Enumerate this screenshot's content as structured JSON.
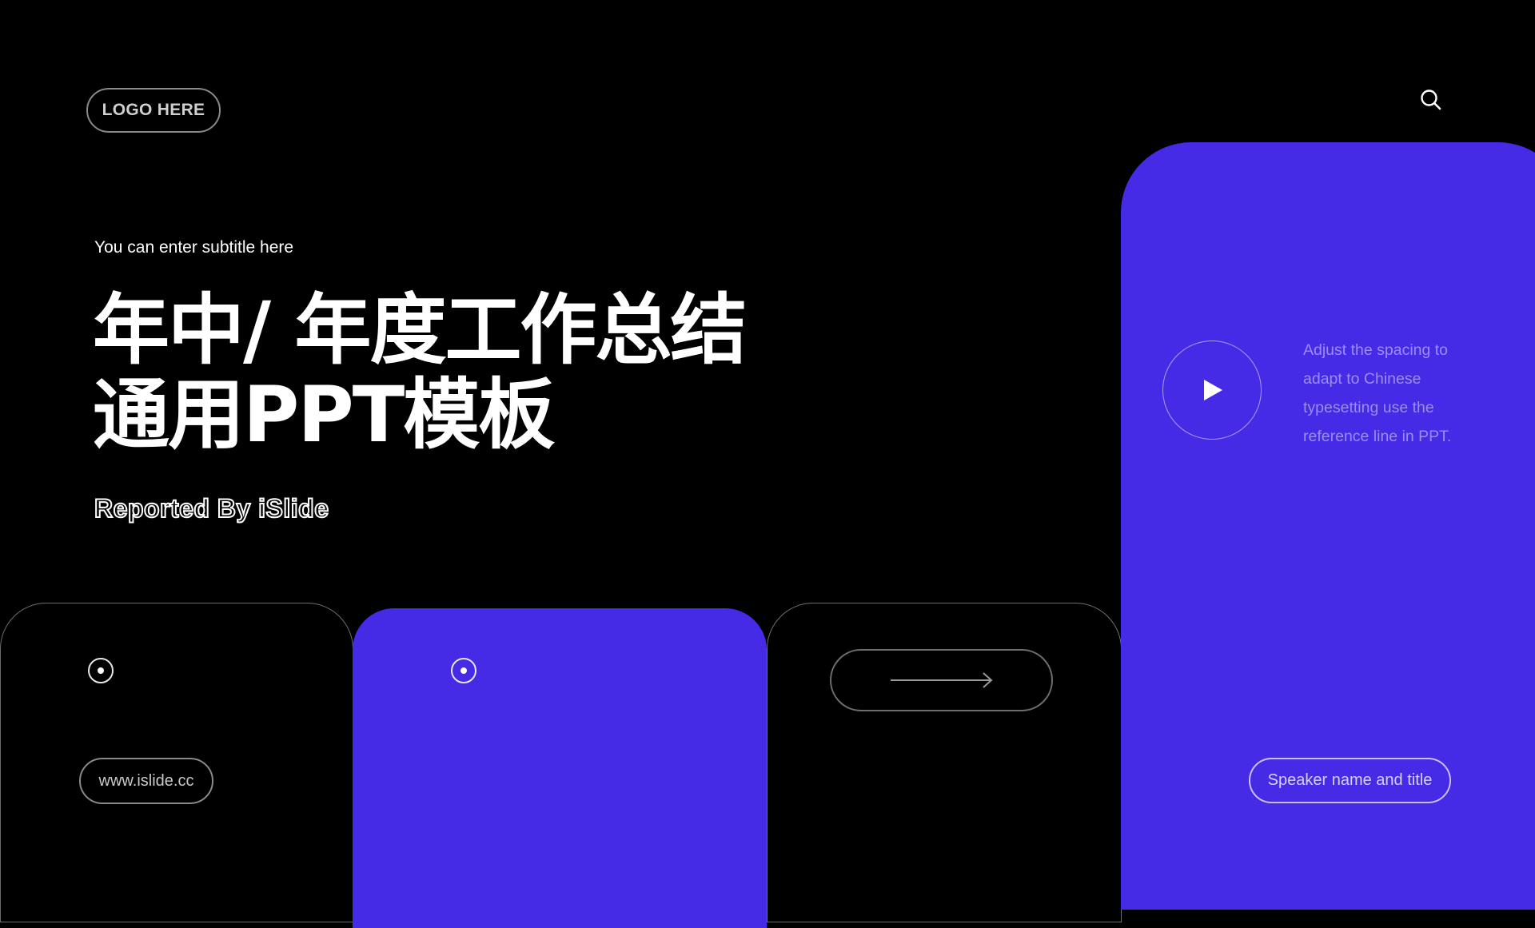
{
  "header": {
    "logo_label": "LOGO HERE",
    "search_icon": "search-icon"
  },
  "hero": {
    "subtitle": "You can enter subtitle here",
    "title_line1": "年中/ 年度工作总结",
    "title_line2": "通用PPT模板",
    "reported_by": "Reported By iSlide"
  },
  "footer_cards": {
    "website": "www.islide.cc",
    "arrow_icon": "arrow-right-icon",
    "dot_icon": "target-dot-icon"
  },
  "side_panel": {
    "play_icon": "play-icon",
    "description_lines": [
      "Adjust the spacing to",
      "adapt to Chinese",
      "typesetting use the",
      "reference line in PPT."
    ],
    "speaker_label": "Speaker name and title"
  },
  "colors": {
    "background": "#000000",
    "accent_purple": "#452ae6",
    "text_white": "#ffffff",
    "muted_purple_text": "#9a8ef2",
    "outline_gray": "#6e6e6e"
  }
}
